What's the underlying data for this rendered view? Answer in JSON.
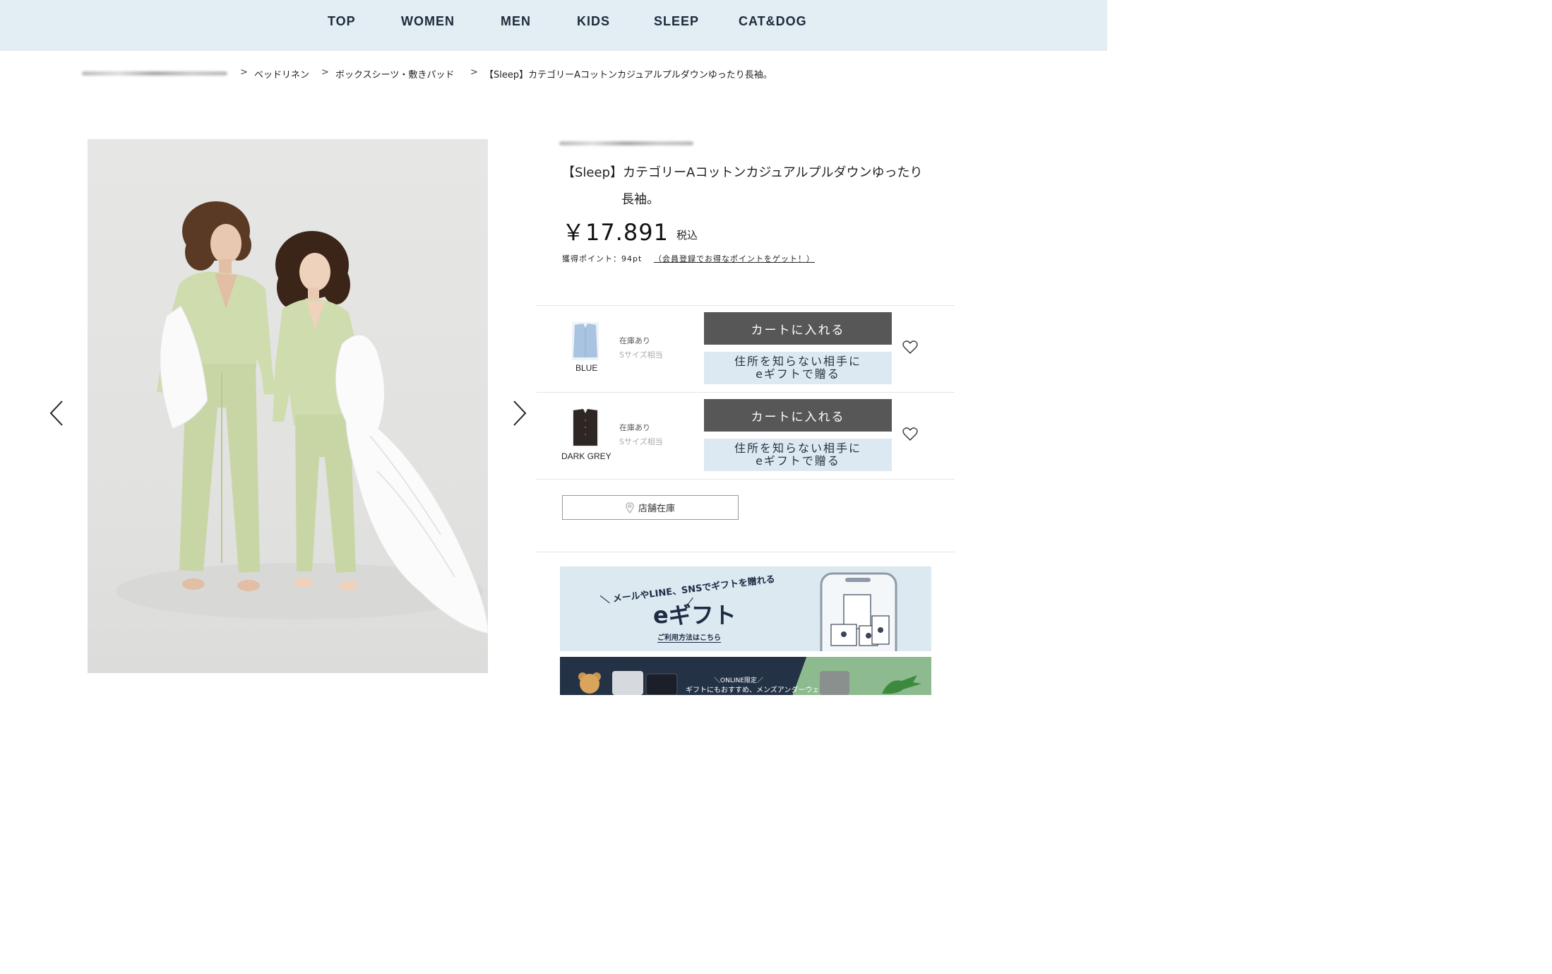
{
  "nav": {
    "items": [
      "TOP",
      "WOMEN",
      "MEN",
      "KIDS",
      "SLEEP",
      "CAT&DOG"
    ]
  },
  "breadcrumb": {
    "items": [
      "ベッドリネン",
      "ボックスシーツ・敷きパッド",
      "【Sleep】カテゴリーAコットンカジュアルプルダウンゆったり長袖。"
    ],
    "separator": ">"
  },
  "product": {
    "title_line1": "【Sleep】カテゴリーAコットンカジュアルプルダウンゆったり",
    "title_line2": "長袖。",
    "price": "￥17.891",
    "tax_label": "税込",
    "points_text": "獲得ポイント：94pt",
    "points_link": "（会員登録でお得なポイントをゲット！）"
  },
  "variants": [
    {
      "color": "BLUE",
      "swatch_color": "#a9c3e0",
      "stock": "在庫あり",
      "size": "Sサイズ相当",
      "cart_label": "カートに入れる",
      "gift_line1": "住所を知らない相手に",
      "gift_line2": "eギフトで贈る"
    },
    {
      "color": "DARK GREY",
      "swatch_color": "#2e2622",
      "stock": "在庫あり",
      "size": "Sサイズ相当",
      "cart_label": "カートに入れる",
      "gift_line1": "住所を知らない相手に",
      "gift_line2": "eギフトで贈る"
    }
  ],
  "store_stock": {
    "label": "店舗在庫",
    "icon": "location-pin-icon"
  },
  "banner_egift": {
    "tagline": "＼ メールやLINE、SNSでギフトを贈れる ／",
    "title": "eギフト",
    "link": "ご利用方法はこちら"
  },
  "banner_underwear": {
    "tag": "＼ONLINE限定／",
    "text": "ギフトにもおすすめ、メンズアンダーウェア"
  },
  "colors": {
    "nav_bg": "#e3edf4",
    "cart_button": "#575757",
    "gift_button": "#dce9f2",
    "pajama_green": "#cfdcae"
  }
}
